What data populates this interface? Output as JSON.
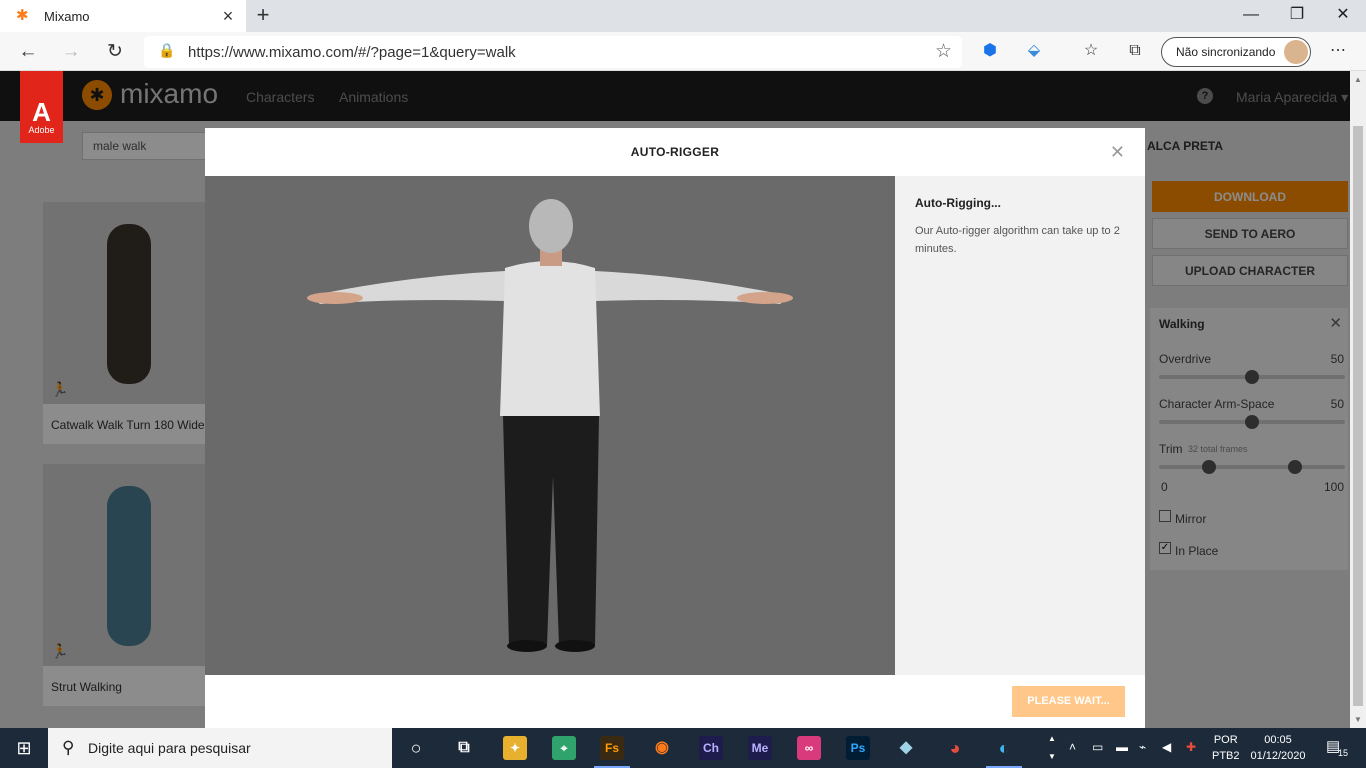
{
  "browser": {
    "tab_title": "Mixamo",
    "tab_icon": "mixamo-runner-icon",
    "url": "https://www.mixamo.com/#/?page=1&query=walk",
    "sync_label": "Não sincronizando"
  },
  "mixamo": {
    "adobe_label": "Adobe",
    "logo_text": "mixamo",
    "nav": [
      "Characters",
      "Animations"
    ],
    "user_name": "Maria Aparecida",
    "search_value": "male walk"
  },
  "results": [
    {
      "title": "Catwalk Walk Turn 180 Wide"
    },
    {
      "title": "Strut Walking"
    }
  ],
  "right_panel": {
    "title": "ALCA PRETA",
    "download_label": "DOWNLOAD",
    "aero_label": "SEND TO AERO",
    "upload_label": "UPLOAD CHARACTER",
    "anim_name": "Walking",
    "sliders": [
      {
        "label": "Overdrive",
        "value": "50"
      },
      {
        "label": "Character Arm-Space",
        "value": "50"
      }
    ],
    "trim_label": "Trim",
    "trim_frames": "32 total frames",
    "trim_min": "0",
    "trim_max": "100",
    "mirror_label": "Mirror",
    "inplace_label": "In Place"
  },
  "modal": {
    "title": "AUTO-RIGGER",
    "status_heading": "Auto-Rigging...",
    "status_text": "Our Auto-rigger algorithm can take up to 2 minutes.",
    "button_label": "PLEASE WAIT..."
  },
  "taskbar": {
    "search_placeholder": "Digite aqui para pesquisar",
    "lang_top": "POR",
    "lang_bottom": "PTB2",
    "time": "00:05",
    "date": "01/12/2020",
    "notifications": "15"
  },
  "colors": {
    "accent": "#ff8a00",
    "adobe_red": "#e1251b"
  }
}
